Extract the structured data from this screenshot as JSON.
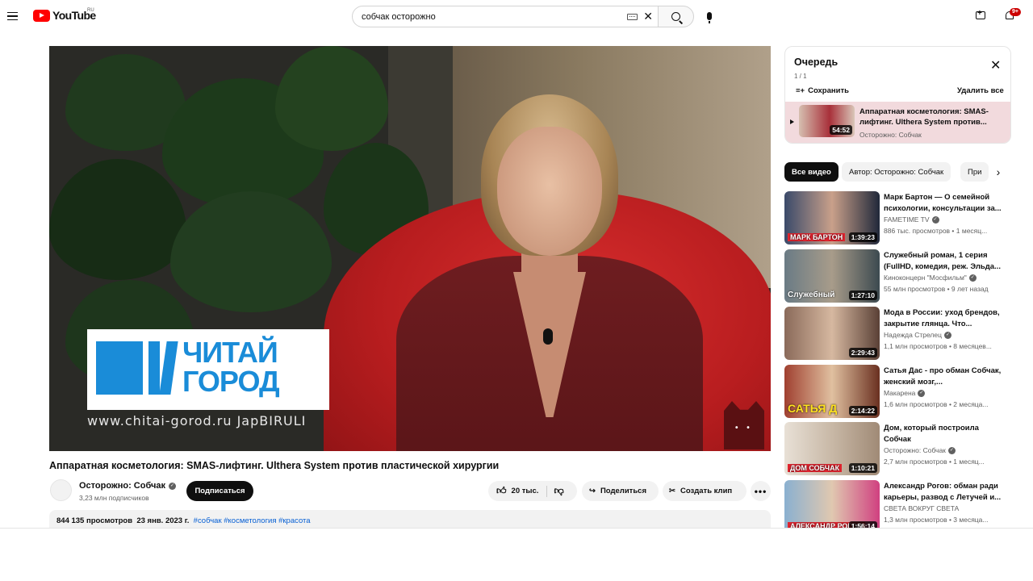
{
  "header": {
    "logo_text": "YouTube",
    "country_code": "RU",
    "search_value": "собчак осторожно",
    "notification_count": "9+"
  },
  "player": {
    "brand_name": "ЧИТАЙ ГОРОД",
    "brand_url": "www.chitai-gorod.ru JapBIRULI"
  },
  "video": {
    "title": "Аппаратная косметология: SMAS-лифтинг. Ulthera System против пластической хирургии",
    "channel_name": "Осторожно: Собчак",
    "subscribers": "3,23 млн подписчиков",
    "subscribe_label": "Подписаться",
    "likes": "20 тыс.",
    "share_label": "Поделиться",
    "clip_label": "Создать клип",
    "more_label": "•••",
    "views": "844 135 просмотров",
    "date": "23 янв. 2023 г.",
    "tags": "#собчак #косметология #красота"
  },
  "queue": {
    "title": "Очередь",
    "count": "1 / 1",
    "save_label": "Сохранить",
    "delete_label": "Удалить все",
    "item": {
      "title": "Аппаратная косметология: SMAS-лифтинг. Ulthera System против...",
      "channel": "Осторожно: Собчак",
      "duration": "54:52"
    }
  },
  "chips": [
    "Все видео",
    "Автор: Осторожно: Собчак",
    "При"
  ],
  "recommendations": [
    {
      "title": "Марк Бартон — О семейной психологии, консультации за...",
      "channel": "FAMETIME TV",
      "verified": true,
      "meta": "886 тыс. просмотров • 1 месяц...",
      "duration": "1:39:23",
      "caption": "МАРК БАРТОН",
      "thumb_colors": [
        "#3a4a6a",
        "#c9a08a",
        "#20283a"
      ]
    },
    {
      "title": "Служебный роман, 1 серия (FullHD, комедия, реж. Эльда...",
      "channel": "Киноконцерн \"Мосфильм\"",
      "verified": true,
      "meta": "55 млн просмотров • 9 лет назад",
      "duration": "1:27:10",
      "caption": "Служебный",
      "thumb_colors": [
        "#6a7b85",
        "#a89c8a",
        "#3c4a50"
      ]
    },
    {
      "title": "Мода в России: уход брендов, закрытие глянца. Что...",
      "channel": "Надежда Стрелец",
      "verified": true,
      "meta": "1,1 млн просмотров • 8 месяцев...",
      "duration": "2:29:43",
      "caption": "",
      "thumb_colors": [
        "#8a6a5a",
        "#d6b8a0",
        "#5a4036"
      ]
    },
    {
      "title": "Сатья Дас - про обман Собчак, женский мозг,...",
      "channel": "Макарена",
      "verified": true,
      "meta": "1,6 млн просмотров • 2 месяца...",
      "duration": "2:14:22",
      "caption": "САТЬЯ Д",
      "thumb_colors": [
        "#a04030",
        "#e0c0a0",
        "#6a3020"
      ]
    },
    {
      "title": "Дом, который построила Собчак",
      "channel": "Осторожно: Собчак",
      "verified": true,
      "meta": "2,7 млн просмотров • 1 месяц...",
      "duration": "1:10:21",
      "caption": "ДОМ СОБЧАК",
      "thumb_colors": [
        "#e8e0d6",
        "#c8b8a6",
        "#a08a76"
      ]
    },
    {
      "title": "Александр Рогов: обман ради карьеры, развод с Летучей и...",
      "channel": "СВЕТА ВОКРУГ СВЕТА",
      "verified": false,
      "meta": "1,3 млн просмотров • 3 месяца...",
      "duration": "1:56:14",
      "caption": "АЛЕКСАНДР РОГОВ",
      "thumb_colors": [
        "#8ab0d0",
        "#e0c8b0",
        "#d04080"
      ]
    }
  ],
  "colors": {
    "accent_red": "#ff0000",
    "link_blue": "#065fd4",
    "brand_blue": "#1a8cd8",
    "queue_highlight": "#f2dadd"
  }
}
